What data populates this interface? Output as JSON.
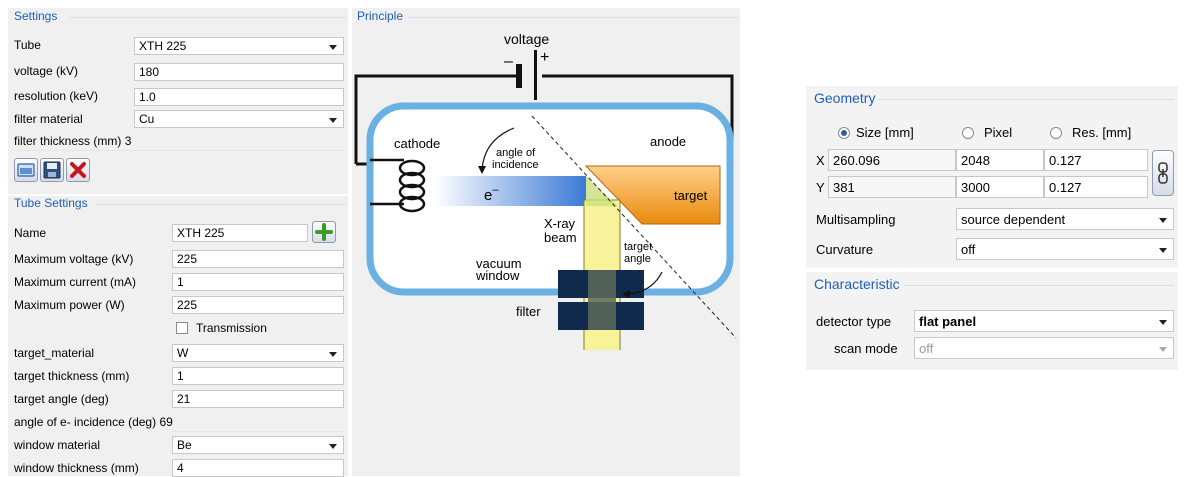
{
  "settings": {
    "title": "Settings",
    "rows": [
      {
        "label": "Tube",
        "value": "XTH 225"
      },
      {
        "label": "voltage (kV)",
        "value": "180"
      },
      {
        "label": "resolution (keV)",
        "value": "1.0"
      },
      {
        "label": "filter material",
        "value": "Cu"
      },
      {
        "label": "filter thickness (mm)",
        "value": "3"
      }
    ]
  },
  "tube_settings": {
    "title": "Tube Settings",
    "rows": [
      {
        "label": "Name",
        "value": "XTH 225"
      },
      {
        "label": "Maximum voltage (kV)",
        "value": "225"
      },
      {
        "label": "Maximum current (mA)",
        "value": "1"
      },
      {
        "label": "Maximum power (W)",
        "value": "225"
      },
      {
        "label": "target_material",
        "value": "W"
      },
      {
        "label": "target thickness (mm)",
        "value": "1"
      },
      {
        "label": "target angle (deg)",
        "value": "21"
      },
      {
        "label": "angle of e- incidence (deg)",
        "value": "69"
      },
      {
        "label": "window material",
        "value": "Be"
      },
      {
        "label": "window thickness (mm)",
        "value": "4"
      }
    ],
    "transmission_label": "Transmission",
    "transmission_checked": false
  },
  "principle": {
    "title": "Principle",
    "labels": {
      "voltage": "voltage",
      "minus": "–",
      "plus": "+",
      "cathode": "cathode",
      "anode": "anode",
      "angle_of": "angle of",
      "incidence": "incidence",
      "electron": "e",
      "electron_sup": "–",
      "target": "target",
      "xray": "X-ray",
      "beam": "beam",
      "target_angle_1": "target",
      "target_angle_2": "angle",
      "vacuum": "vacuum",
      "window": "window",
      "filter": "filter"
    }
  },
  "geometry": {
    "title": "Geometry",
    "radios": [
      "Size [mm]",
      "Pixel",
      "Res. [mm]"
    ],
    "selected_radio": 0,
    "x_label": "X",
    "y_label": "Y",
    "x_values": [
      "260.096",
      "2048",
      "0.127"
    ],
    "y_values": [
      "381",
      "3000",
      "0.127"
    ],
    "multisampling_label": "Multisampling",
    "multisampling_value": "source dependent",
    "curvature_label": "Curvature",
    "curvature_value": "off"
  },
  "characteristic": {
    "title": "Characteristic",
    "detector_type_label": "detector type",
    "detector_type_value": "flat panel",
    "scan_mode_label": "scan mode",
    "scan_mode_value": "off"
  },
  "colors": {
    "accent": "#1f5fb8",
    "tube_outline": "#6ab0e0",
    "target_orange": "#f39c12",
    "beam_yellow": "#f7f39a",
    "filter_navy": "#0f2a4a"
  }
}
